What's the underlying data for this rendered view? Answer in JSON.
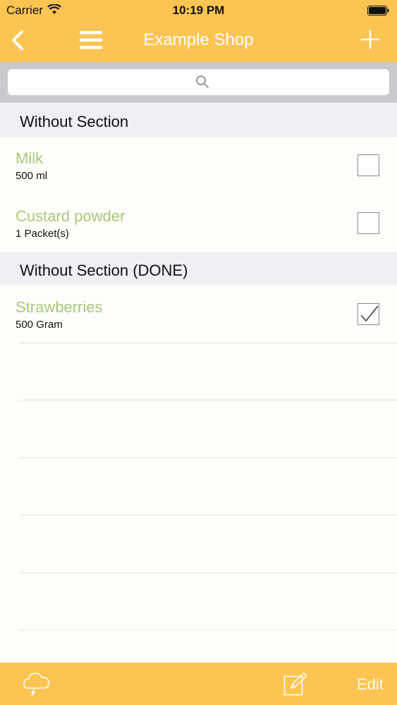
{
  "status": {
    "carrier": "Carrier",
    "time": "10:19 PM"
  },
  "nav": {
    "title": "Example Shop",
    "back_icon": "chevron-left-icon",
    "menu_icon": "hamburger-icon",
    "add_icon": "plus-icon"
  },
  "search": {
    "placeholder": "",
    "icon": "search-icon"
  },
  "sections": [
    {
      "title": "Without Section",
      "items": [
        {
          "name": "Milk",
          "quantity": "500 ml",
          "checked": false
        },
        {
          "name": "Custard powder",
          "quantity": "1 Packet(s)",
          "checked": false
        }
      ]
    },
    {
      "title": "Without Section (DONE)",
      "items": [
        {
          "name": "Strawberries",
          "quantity": "500 Gram",
          "checked": true
        }
      ]
    }
  ],
  "toolbar": {
    "cloud_icon": "cloud-lightning-icon",
    "compose_icon": "compose-icon",
    "edit_label": "Edit"
  },
  "colors": {
    "accent": "#fcc452",
    "item_name": "#a8c87a",
    "section_bg": "#efeff4",
    "search_bg": "#c9c9ce"
  }
}
